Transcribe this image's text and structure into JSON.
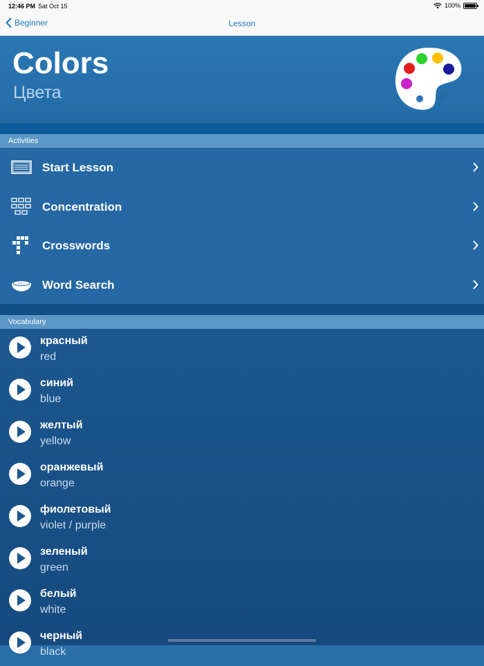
{
  "status": {
    "time": "12:46 PM",
    "date": "Sat Oct 15",
    "battery": "100%"
  },
  "nav": {
    "back_label": "Beginner",
    "title": "Lesson"
  },
  "header": {
    "title": "Colors",
    "subtitle": "Цвета"
  },
  "palette_colors": [
    "#e51c1c",
    "#2ed02e",
    "#ffc000",
    "#1a1a9c",
    "#cc22cc",
    "#2b74b8"
  ],
  "sections": {
    "activities": "Activities",
    "vocabulary": "Vocabulary"
  },
  "activities": [
    {
      "label": "Start Lesson",
      "icon": "flashcard-icon"
    },
    {
      "label": "Concentration",
      "icon": "grid-icon"
    },
    {
      "label": "Crosswords",
      "icon": "crossword-icon"
    },
    {
      "label": "Word Search",
      "icon": "word-search-icon"
    }
  ],
  "vocabulary": [
    {
      "word": "красный",
      "translation": "red"
    },
    {
      "word": "синий",
      "translation": "blue"
    },
    {
      "word": "желтый",
      "translation": "yellow"
    },
    {
      "word": "оранжевый",
      "translation": "orange"
    },
    {
      "word": "фиолетовый",
      "translation": "violet / purple"
    },
    {
      "word": "зеленый",
      "translation": "green"
    },
    {
      "word": "белый",
      "translation": "white"
    },
    {
      "word": "черный",
      "translation": "black"
    }
  ]
}
